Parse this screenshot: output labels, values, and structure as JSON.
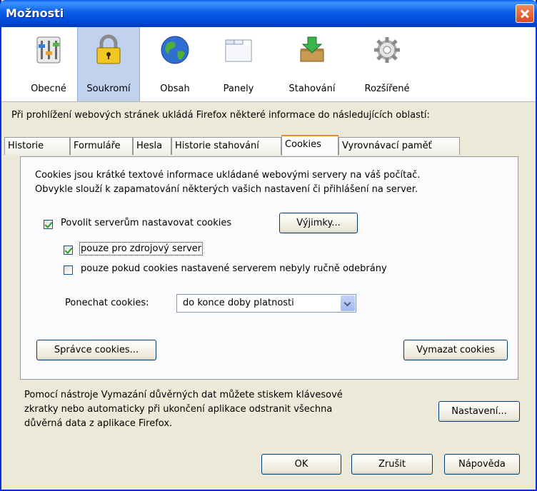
{
  "window": {
    "title": "Možnosti"
  },
  "toolbar": {
    "panes": [
      {
        "label": "Obecné",
        "icon": "general-icon"
      },
      {
        "label": "Soukromí",
        "icon": "lock-icon",
        "selected": true
      },
      {
        "label": "Obsah",
        "icon": "globe-icon"
      },
      {
        "label": "Panely",
        "icon": "tabs-window-icon"
      },
      {
        "label": "Stahování",
        "icon": "download-icon"
      },
      {
        "label": "Rozšířené",
        "icon": "gear-icon"
      }
    ]
  },
  "intro": "Při prohlížení webových stránek ukládá Firefox některé informace do následujících oblastí:",
  "tabs": [
    "Historie",
    "Formuláře",
    "Hesla",
    "Historie stahování",
    "Cookies",
    "Vyrovnávací paměť"
  ],
  "active_tab": "Cookies",
  "cookies": {
    "desc_line1": "Cookies jsou krátké textové informace ukládané webovými servery na váš počítač.",
    "desc_line2": "Obvykle slouží k zapamatování některých vašich nastavení či přihlášení na server.",
    "allow_label": "Povolit serverům nastavovat cookies",
    "allow_checked": true,
    "exceptions_label": "Výjimky...",
    "origin_only_label": "pouze pro zdrojový server",
    "origin_only_checked": true,
    "unless_removed_label": "pouze pokud cookies nastavené serverem nebyly ručně odebrány",
    "unless_removed_checked": false,
    "keep_label": "Ponechat cookies:",
    "keep_value": "do konce doby platnosti",
    "manager_label": "Správce cookies...",
    "clear_label": "Vymazat cookies"
  },
  "private_data": {
    "line1": "Pomocí nástroje Vymazání důvěrných dat můžete stiskem klávesové",
    "line2": "zkratky nebo automaticky při ukončení aplikace odstranit všechna",
    "line3": "důvěrná data z aplikace Firefox.",
    "settings_label": "Nastavení..."
  },
  "buttons": {
    "ok": "OK",
    "cancel": "Zrušit",
    "help": "Nápověda"
  }
}
